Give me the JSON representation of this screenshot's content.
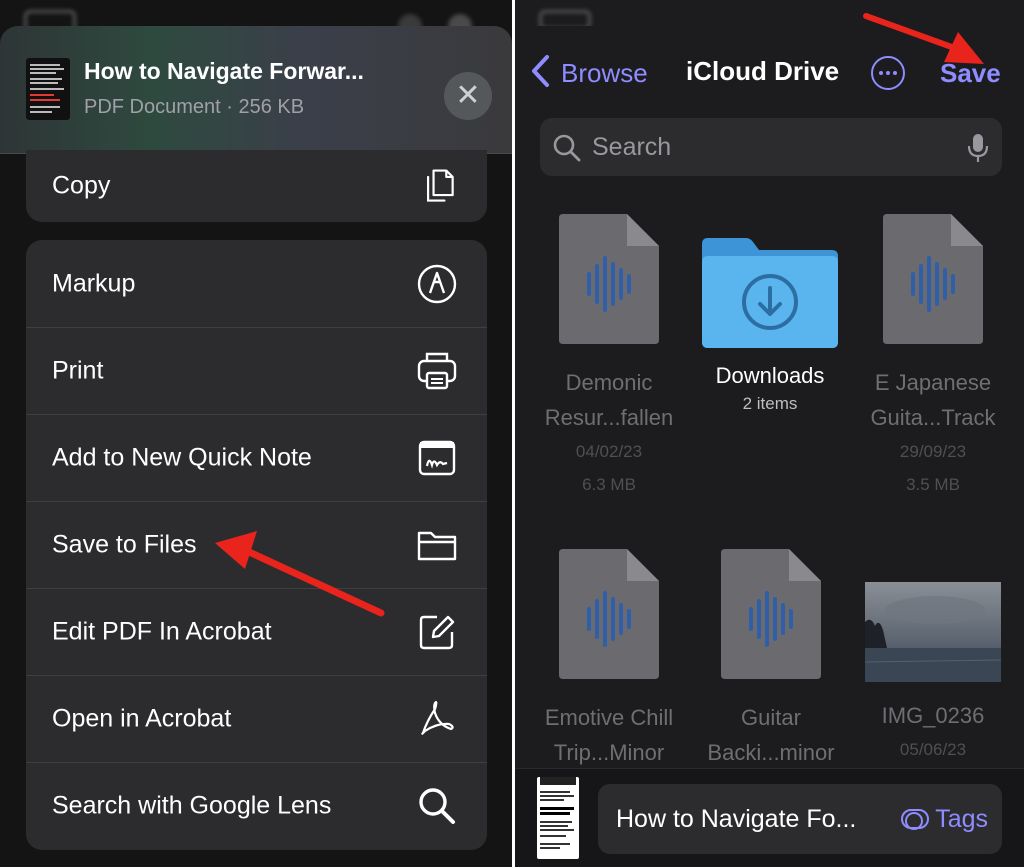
{
  "share_sheet": {
    "document": {
      "title": "How to Navigate Forwar...",
      "subtitle": "PDF Document · 256 KB"
    },
    "close_label": "✕",
    "copy_label": "Copy",
    "actions": [
      {
        "label": "Markup",
        "icon": "markup-icon"
      },
      {
        "label": "Print",
        "icon": "printer-icon"
      },
      {
        "label": "Add to New Quick Note",
        "icon": "quick-note-icon"
      },
      {
        "label": "Save to Files",
        "icon": "folder-icon"
      },
      {
        "label": "Edit PDF In Acrobat",
        "icon": "edit-icon"
      },
      {
        "label": "Open in Acrobat",
        "icon": "acrobat-icon"
      },
      {
        "label": "Search with Google Lens",
        "icon": "search-icon"
      }
    ]
  },
  "picker": {
    "back_label": "Browse",
    "title": "iCloud Drive",
    "save_label": "Save",
    "search_placeholder": "Search",
    "files": [
      {
        "name1": "Demonic",
        "name2": "Resur...fallen",
        "date": "04/02/23",
        "size": "6.3 MB",
        "kind": "audio"
      },
      {
        "name1": "Downloads",
        "name2": "",
        "date": "2 items",
        "size": "",
        "kind": "folder"
      },
      {
        "name1": "E Japanese",
        "name2": "Guita...Track",
        "date": "29/09/23",
        "size": "3.5 MB",
        "kind": "audio"
      },
      {
        "name1": "Emotive Chill",
        "name2": "Trip...Minor",
        "date": "",
        "size": "",
        "kind": "audio"
      },
      {
        "name1": "Guitar",
        "name2": "Backi...minor",
        "date": "",
        "size": "",
        "kind": "audio"
      },
      {
        "name1": "IMG_0236",
        "name2": "",
        "date": "05/06/23",
        "size": "",
        "kind": "image"
      }
    ],
    "bottom": {
      "filename": "How to Navigate Fo...",
      "tags_label": "Tags"
    }
  },
  "colors": {
    "accent": "#8e8cff",
    "arrow": "#e8241c",
    "folder": "#5ab4ee",
    "audio_wave": "#2f5fa8"
  }
}
